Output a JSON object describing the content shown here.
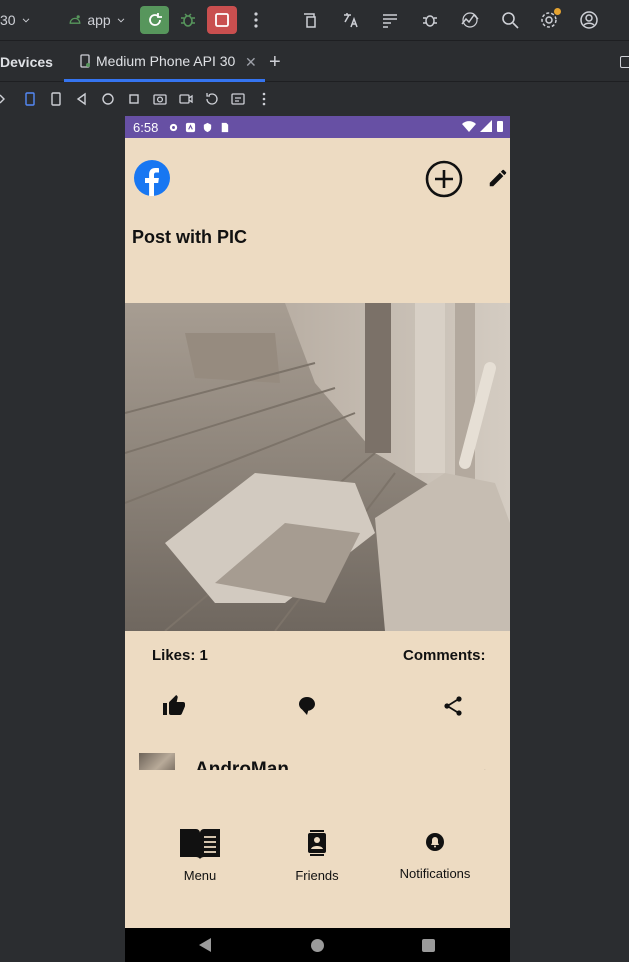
{
  "toolbar": {
    "api_level": "30",
    "app_selector": "app",
    "colors": {
      "run": "#57965c",
      "stop": "#c94f4f",
      "accent": "#3574f0"
    },
    "icons": [
      "run-icon",
      "debug-icon",
      "stop-icon",
      "more-icon",
      "device-manager-icon",
      "translate-icon",
      "logcat-icon",
      "bug-icon",
      "profiler-icon",
      "search-icon",
      "settings-icon",
      "account-icon"
    ]
  },
  "tabs": {
    "devices_label": "Devices",
    "active_tab": "Medium Phone API 30"
  },
  "phone": {
    "status": {
      "time": "6:58"
    },
    "post": {
      "title": "Post with PIC",
      "likes": "Likes: 1",
      "comments": "Comments:"
    },
    "comment": {
      "author": "AndroMan"
    },
    "nav": {
      "menu": "Menu",
      "friends": "Friends",
      "notifications": "Notifications"
    },
    "colors": {
      "background": "#eddbc2",
      "statusbar": "#6750a4",
      "facebook": "#1877f2"
    }
  }
}
